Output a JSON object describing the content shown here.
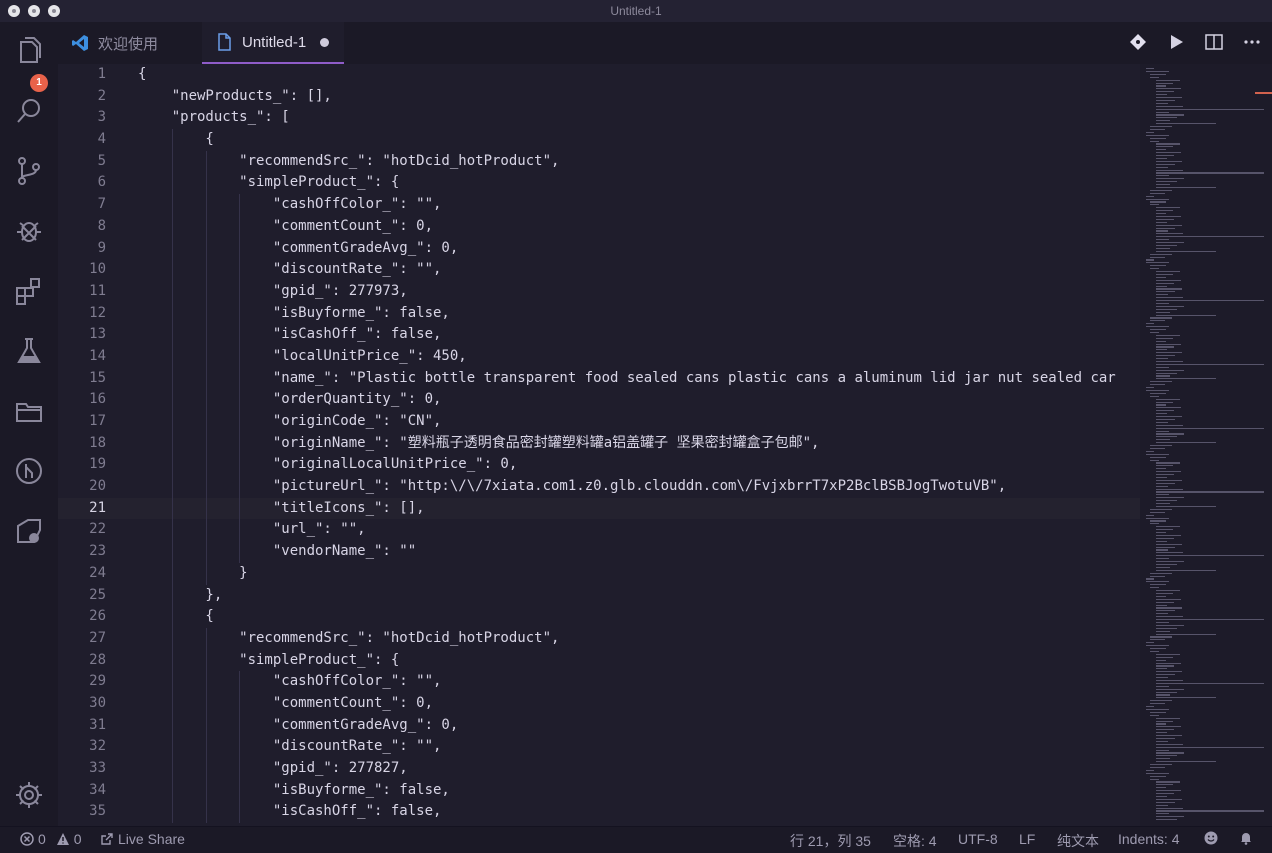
{
  "window": {
    "title": "Untitled-1"
  },
  "activity_bar": {
    "explorer_badge": "1"
  },
  "tabs": [
    {
      "label": "欢迎使用"
    },
    {
      "label": "Untitled-1"
    }
  ],
  "editor": {
    "lines": [
      {
        "n": "1",
        "text": "{"
      },
      {
        "n": "2",
        "text": "    \"newProducts_\": [],"
      },
      {
        "n": "3",
        "text": "    \"products_\": ["
      },
      {
        "n": "4",
        "text": "        {"
      },
      {
        "n": "5",
        "text": "            \"recommendSrc_\": \"hotDcid_hotProduct\","
      },
      {
        "n": "6",
        "text": "            \"simpleProduct_\": {"
      },
      {
        "n": "7",
        "text": "                \"cashOffColor_\": \"\","
      },
      {
        "n": "8",
        "text": "                \"commentCount_\": 0,"
      },
      {
        "n": "9",
        "text": "                \"commentGradeAvg_\": 0,"
      },
      {
        "n": "10",
        "text": "                \"discountRate_\": \"\","
      },
      {
        "n": "11",
        "text": "                \"gpid_\": 277973,"
      },
      {
        "n": "12",
        "text": "                \"isBuyforme_\": false,"
      },
      {
        "n": "13",
        "text": "                \"isCashOff_\": false,"
      },
      {
        "n": "14",
        "text": "                \"localUnitPrice_\": 450,"
      },
      {
        "n": "15",
        "text": "                \"name_\": \"Plastic bottle transparent food sealed cans plastic cans a aluminum lid jar nut sealed car"
      },
      {
        "n": "16",
        "text": "                \"orderQuantity_\": 0,"
      },
      {
        "n": "17",
        "text": "                \"originCode_\": \"CN\","
      },
      {
        "n": "18",
        "text": "                \"originName_\": \"塑料瓶子透明食品密封罐塑料罐a铝盖罐子 坚果密封罐盒子包邮\","
      },
      {
        "n": "19",
        "text": "                \"originalLocalUnitPrice_\": 0,"
      },
      {
        "n": "20",
        "text": "                \"pictureUrl_\": \"http:\\/\\/7xiata.com1.z0.glb.clouddn.com\\/FvjxbrrT7xP2BclBSBJogTwotuVB\","
      },
      {
        "n": "21",
        "text": "                \"titleIcons_\": [],"
      },
      {
        "n": "22",
        "text": "                \"url_\": \"\","
      },
      {
        "n": "23",
        "text": "                \"vendorName_\": \"\""
      },
      {
        "n": "24",
        "text": "            }"
      },
      {
        "n": "25",
        "text": "        },"
      },
      {
        "n": "26",
        "text": "        {"
      },
      {
        "n": "27",
        "text": "            \"recommendSrc_\": \"hotDcid_hotProduct\","
      },
      {
        "n": "28",
        "text": "            \"simpleProduct_\": {"
      },
      {
        "n": "29",
        "text": "                \"cashOffColor_\": \"\","
      },
      {
        "n": "30",
        "text": "                \"commentCount_\": 0,"
      },
      {
        "n": "31",
        "text": "                \"commentGradeAvg_\": 0,"
      },
      {
        "n": "32",
        "text": "                \"discountRate_\": \"\","
      },
      {
        "n": "33",
        "text": "                \"gpid_\": 277827,"
      },
      {
        "n": "34",
        "text": "                \"isBuyforme_\": false,"
      },
      {
        "n": "35",
        "text": "                \"isCashOff_\": false,"
      }
    ],
    "current_line": "21"
  },
  "statusbar": {
    "errors": "0",
    "warnings": "0",
    "live_share": "Live Share",
    "cursor": "行 21，列 35",
    "spaces": "空格: 4",
    "encoding": "UTF-8",
    "eol": "LF",
    "language": "纯文本",
    "indents": "Indents: 4"
  },
  "icons": {
    "activity": [
      "files-icon",
      "search-icon",
      "source-control-icon",
      "debug-icon",
      "extensions-icon",
      "test-flask-icon",
      "folder-icon",
      "gitlens-icon",
      "remote-explorer-icon",
      "settings-gear-icon"
    ],
    "toolbar": [
      "git-compare-icon",
      "run-icon",
      "split-editor-icon",
      "more-actions-icon"
    ]
  },
  "colors": {
    "accent": "#8f5cc9",
    "badge": "#e8624a",
    "background": "#1f1d2c"
  }
}
